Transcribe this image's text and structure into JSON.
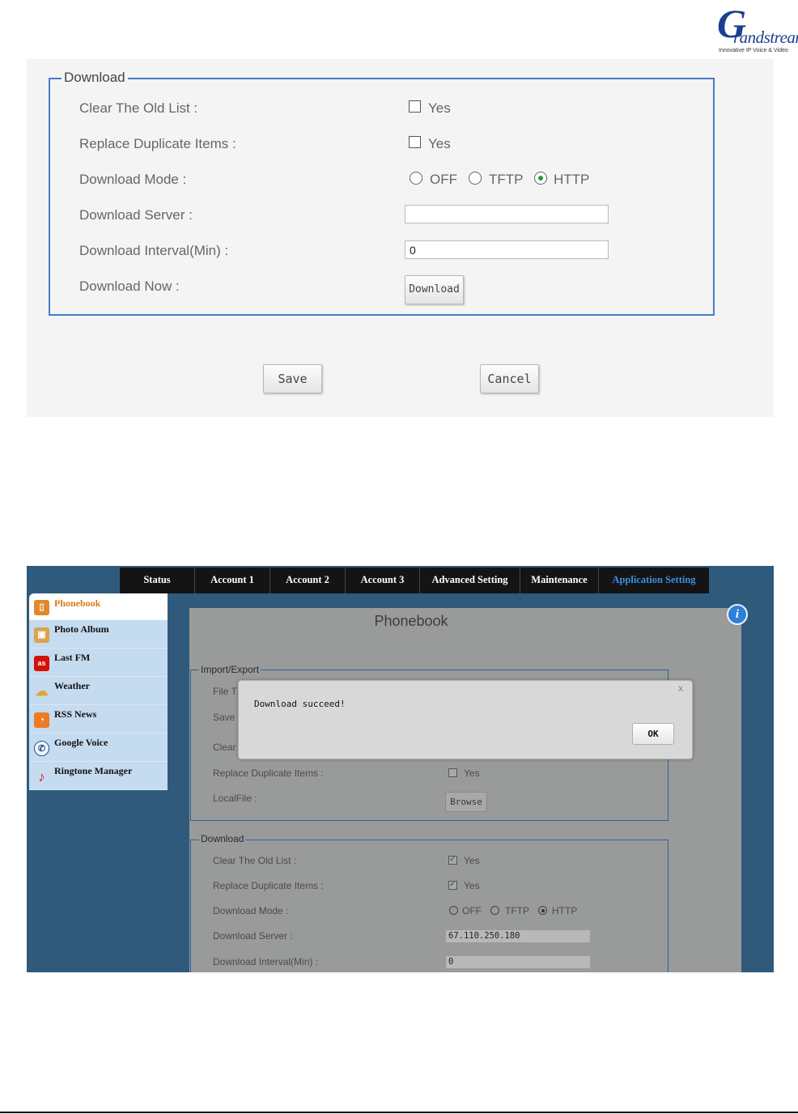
{
  "logo": {
    "initial": "G",
    "word": "randstream",
    "tagline": "Innovative IP Voice & Video"
  },
  "download_panel": {
    "legend": "Download",
    "clear_old_list": {
      "label": "Clear The Old List :",
      "option": "Yes",
      "checked": false
    },
    "replace_duplicate": {
      "label": "Replace Duplicate Items :",
      "option": "Yes",
      "checked": false
    },
    "download_mode": {
      "label": "Download Mode :",
      "options": [
        "OFF",
        "TFTP",
        "HTTP"
      ],
      "selected": "HTTP"
    },
    "download_server": {
      "label": "Download Server :",
      "value": ""
    },
    "download_interval": {
      "label": "Download Interval(Min) :",
      "value": "0"
    },
    "download_now": {
      "label": "Download Now :",
      "button": "Download"
    },
    "save_button": "Save",
    "cancel_button": "Cancel"
  },
  "app_screen": {
    "nav": [
      "Status",
      "Account 1",
      "Account 2",
      "Account 3",
      "Advanced Setting",
      "Maintenance",
      "Application Setting"
    ],
    "nav_active": "Application Setting",
    "sidebar": {
      "active": "Phonebook",
      "items": [
        "Photo Album",
        "Last FM",
        "Weather",
        "RSS News",
        "Google Voice",
        "Ringtone Manager"
      ]
    },
    "page_title": "Phonebook",
    "import_export": {
      "legend": "Import/Export",
      "file_label": "File T",
      "save_label": "Save",
      "clear_label": "Clear",
      "replace_label": "Replace Duplicate Items :",
      "replace_option": "Yes",
      "localfile_label": "LocalFile :",
      "browse_button": "Browse"
    },
    "download": {
      "legend": "Download",
      "clear_label": "Clear The Old List :",
      "clear_option": "Yes",
      "replace_label": "Replace Duplicate Items :",
      "replace_option": "Yes",
      "mode_label": "Download Mode :",
      "mode_options": [
        "OFF",
        "TFTP",
        "HTTP"
      ],
      "mode_selected": "HTTP",
      "server_label": "Download Server :",
      "server_value": "67.110.250.180",
      "interval_label": "Download Interval(Min) :",
      "interval_value": "0"
    },
    "dialog": {
      "message": "Download succeed!",
      "ok": "OK",
      "close": "x"
    }
  },
  "colors": {
    "fieldset_border": "#4a7cc7",
    "nav_active": "#3c8fe0",
    "sidebar_active": "#d9781f",
    "sidebar_bg": "#c5dbef",
    "app_bg": "#2f5a7c"
  }
}
